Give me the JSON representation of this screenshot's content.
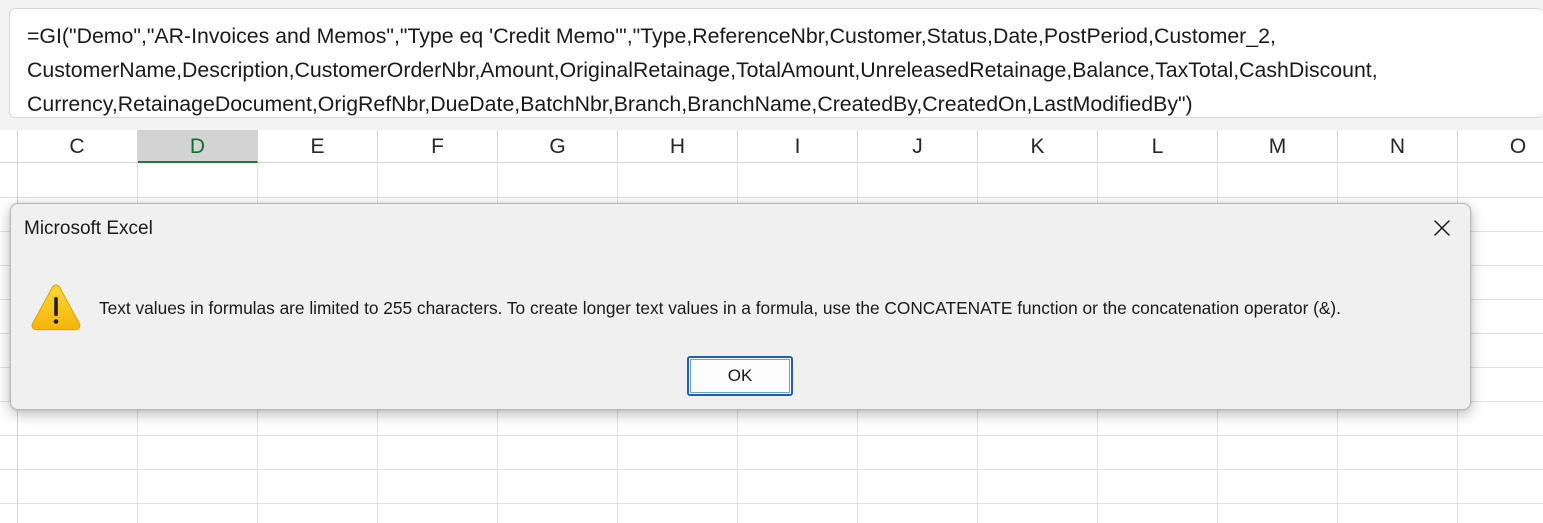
{
  "formula_bar": {
    "lines": [
      "=GI(\"Demo\",\"AR-Invoices and Memos\",\"Type eq 'Credit Memo'\",\"Type,ReferenceNbr,Customer,Status,Date,PostPeriod,Customer_2,",
      "CustomerName,Description,CustomerOrderNbr,Amount,OriginalRetainage,TotalAmount,UnreleasedRetainage,Balance,TaxTotal,CashDiscount,",
      "Currency,RetainageDocument,OrigRefNbr,DueDate,BatchNbr,Branch,BranchName,CreatedBy,CreatedOn,LastModifiedBy\")"
    ]
  },
  "columns": [
    "C",
    "D",
    "E",
    "F",
    "G",
    "H",
    "I",
    "J",
    "K",
    "L",
    "M",
    "N",
    "O"
  ],
  "selected_column": "D",
  "dialog": {
    "title": "Microsoft Excel",
    "icon": "warning-icon",
    "message": "Text values in formulas are limited to 255 characters. To create longer text values in a formula, use the CONCATENATE function or the concatenation operator (&).",
    "ok_label": "OK"
  },
  "colors": {
    "accent_green": "#1e7a3c",
    "button_focus_blue": "#1f5fb0",
    "warning_yellow": "#f9c416"
  }
}
